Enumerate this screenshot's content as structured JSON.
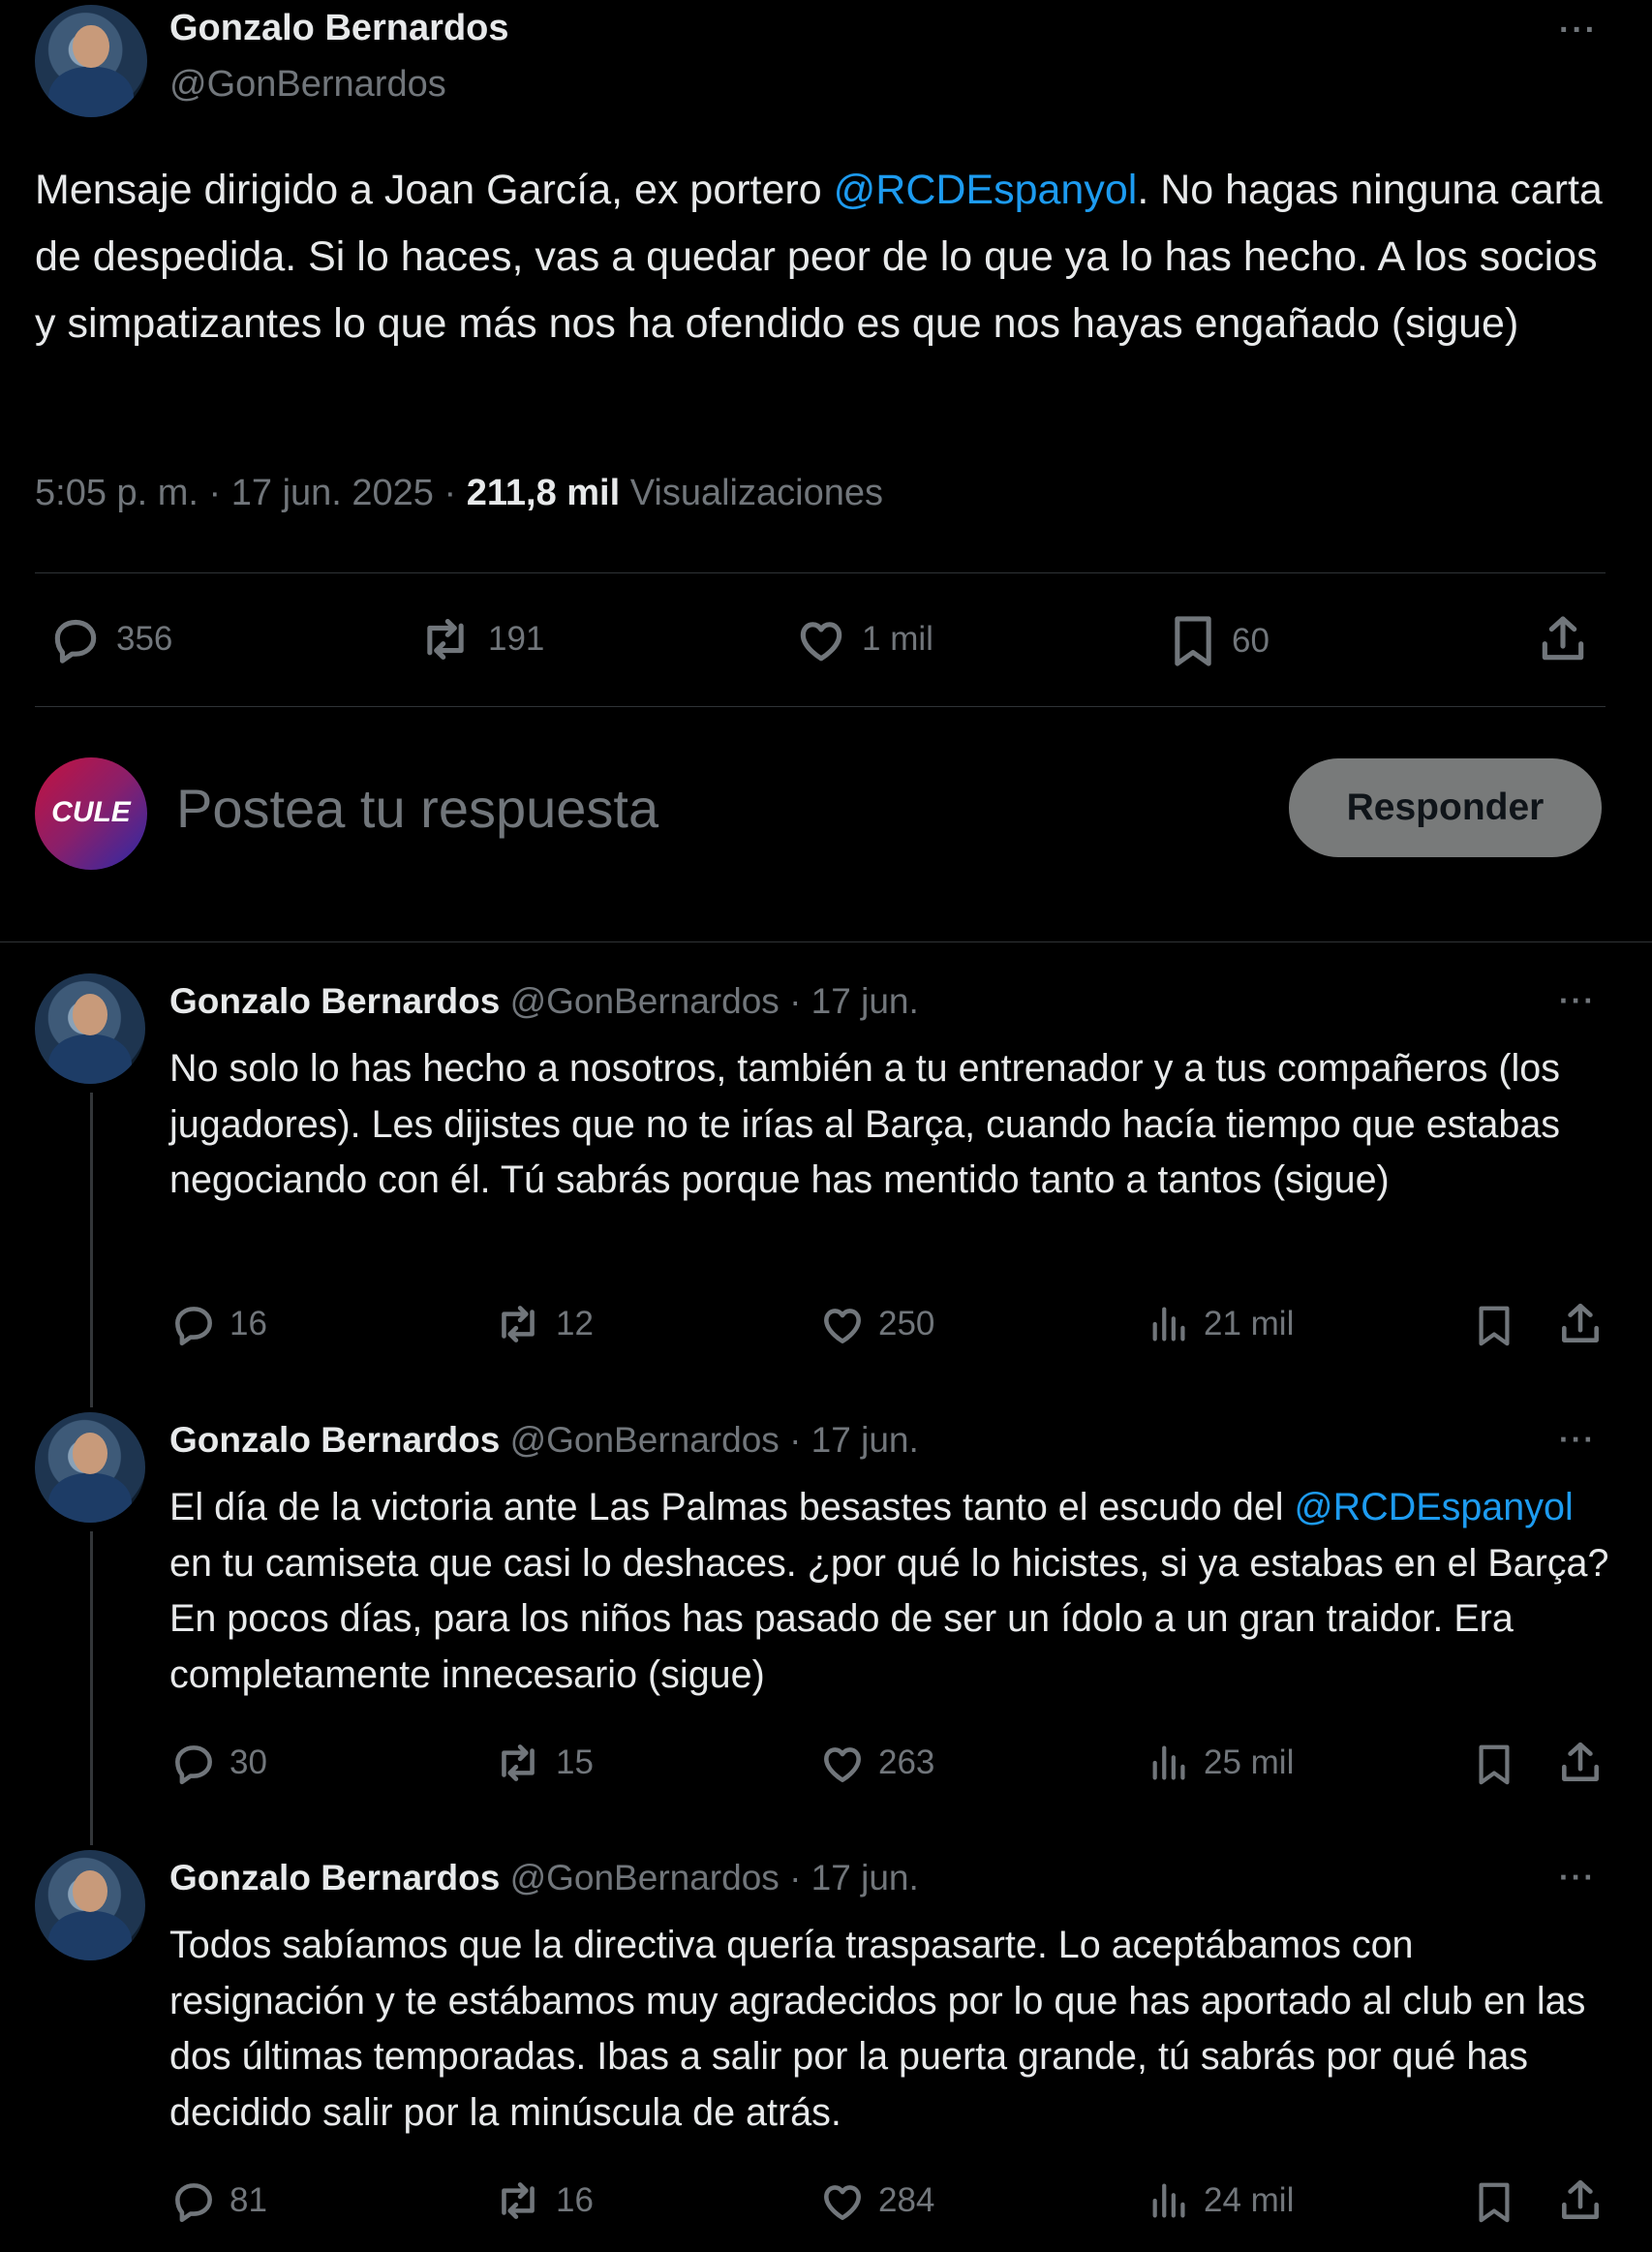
{
  "main_tweet": {
    "author_name": "Gonzalo Bernardos",
    "handle": "@GonBernardos",
    "text_before": "Mensaje dirigido a Joan García, ex portero ",
    "mention": "@RCDEspanyol",
    "text_after": ". No hagas ninguna carta de despedida. Si lo haces, vas a quedar peor de lo que ya lo has hecho. A los socios y simpatizantes lo que más nos ha ofendido es que nos hayas engañado (sigue)",
    "timestamp": "5:05 p. m. · 17 jun. 2025 · ",
    "views_count": "211,8 mil",
    "views_label": "Visualizaciones",
    "replies": "356",
    "reposts": "191",
    "likes": "1 mil",
    "bookmarks": "60"
  },
  "reply_box": {
    "avatar_text": "CULE",
    "placeholder": "Postea tu respuesta",
    "button_label": "Responder"
  },
  "thread": [
    {
      "author_name": "Gonzalo Bernardos",
      "handle": "@GonBernardos",
      "date": "· 17 jun.",
      "text_before": "No solo lo has hecho a nosotros, también a tu entrenador y a tus compañeros (los jugadores). Les dijistes que no te irías al Barça, cuando hacía tiempo que estabas negociando con él. Tú sabrás porque has mentido tanto a tantos (sigue)",
      "mention": "",
      "text_after": "",
      "replies": "16",
      "reposts": "12",
      "likes": "250",
      "views": "21 mil"
    },
    {
      "author_name": "Gonzalo Bernardos",
      "handle": "@GonBernardos",
      "date": "· 17 jun.",
      "text_before": "El día de la victoria ante Las Palmas besastes tanto el escudo del ",
      "mention": "@RCDEspanyol",
      "text_after": " en tu camiseta que casi lo deshaces. ¿por qué lo hicistes, si ya estabas en el Barça? En pocos días, para los niños has pasado de ser un ídolo a un gran traidor. Era completamente innecesario (sigue)",
      "replies": "30",
      "reposts": "15",
      "likes": "263",
      "views": "25 mil"
    },
    {
      "author_name": "Gonzalo Bernardos",
      "handle": "@GonBernardos",
      "date": "· 17 jun.",
      "text_before": "Todos sabíamos que la directiva quería traspasarte. Lo aceptábamos con resignación y te estábamos muy agradecidos por lo que has aportado al club en las dos últimas temporadas. Ibas a salir por la puerta grande, tú sabrás por qué has decidido salir por la minúscula de atrás.",
      "mention": "",
      "text_after": "",
      "replies": "81",
      "reposts": "16",
      "likes": "284",
      "views": "24 mil"
    }
  ],
  "more_glyph": "···",
  "colors": {
    "background": "#000000",
    "text": "#e7e9ea",
    "muted": "#71767b",
    "link": "#1d9bf0",
    "divider": "#2f3336",
    "button": "#787a7a"
  },
  "icons": [
    "reply-icon",
    "repost-icon",
    "like-icon",
    "bookmark-icon",
    "share-icon",
    "views-icon",
    "more-icon"
  ]
}
